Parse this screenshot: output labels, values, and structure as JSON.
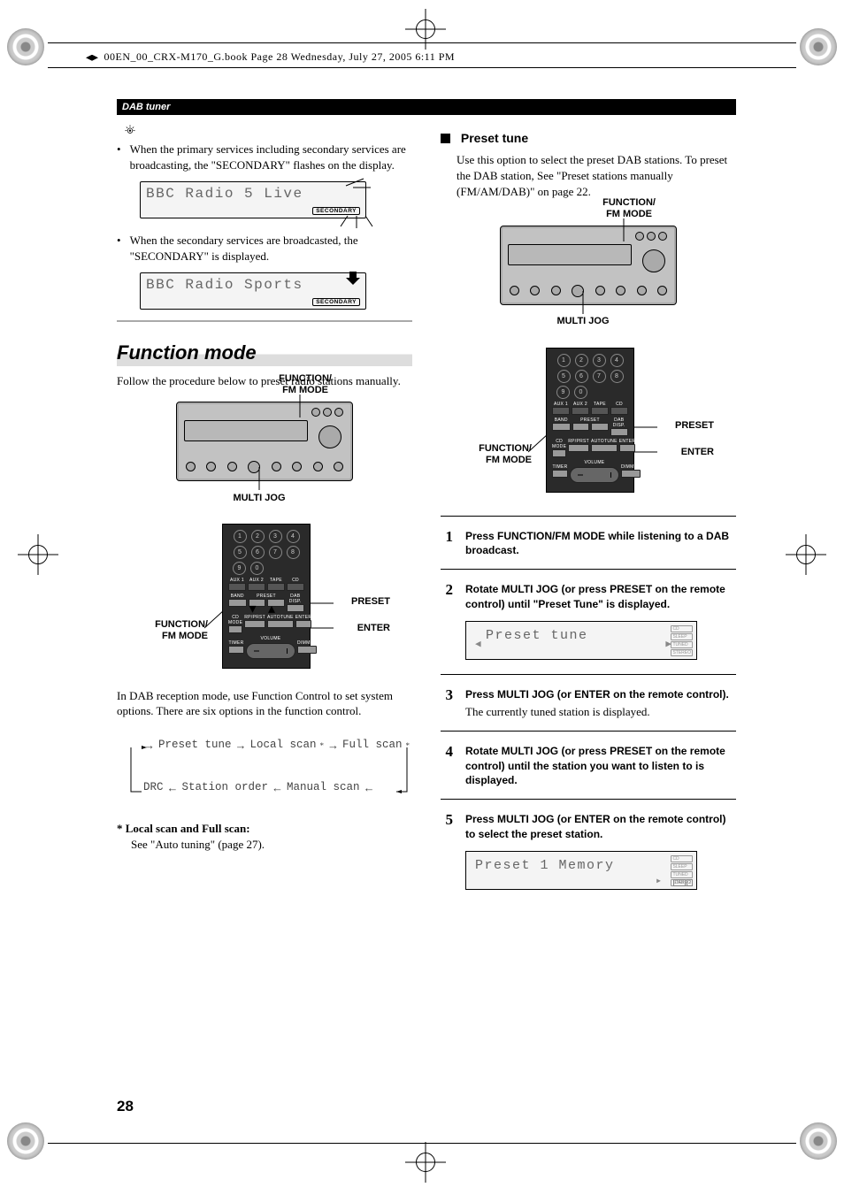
{
  "book_tag": "00EN_00_CRX-M170_G.book  Page 28  Wednesday, July 27, 2005  6:11 PM",
  "section_header": "DAB tuner",
  "left": {
    "bullet1": "When the primary services including secondary services are broadcasting, the \"SECONDARY\" flashes on the display.",
    "lcd1_text": "BBC Radio 5 Live",
    "lcd_badge": "SECONDARY",
    "bullet2": "When the secondary services are broadcasted, the \"SECONDARY\" is displayed.",
    "lcd2_text": "BBC Radio Sports",
    "function_title": "Function mode",
    "function_intro": "Follow the procedure below to preset radio stations manually.",
    "label_function_fm": "FUNCTION/\nFM MODE",
    "label_multijog": "MULTI JOG",
    "label_preset": "PRESET",
    "label_enter": "ENTER",
    "dab_para": "In DAB reception mode, use Function Control to set system options. There are six options  in the function control.",
    "flow": {
      "preset_tune": "Preset tune",
      "local_scan": "Local scan",
      "full_scan": "Full scan",
      "drc": "DRC",
      "station_order": "Station order",
      "manual_scan": "Manual scan"
    },
    "local_full_heading": "* Local scan and Full scan:",
    "local_full_body": "See \"Auto tuning\" (page 27)."
  },
  "right": {
    "preset_tune_h": "Preset tune",
    "preset_para": "Use this option to select the preset DAB stations. To preset the DAB station, See \"Preset stations manually (FM/AM/DAB)\" on page 22.",
    "label_function_fm": "FUNCTION/\nFM MODE",
    "label_multijog": "MULTI JOG",
    "label_preset": "PRESET",
    "label_enter": "ENTER",
    "remote_labels": {
      "aux1": "AUX 1",
      "aux2": "AUX 2",
      "tape": "TAPE",
      "cd": "CD",
      "band": "BAND",
      "preset": "PRESET",
      "dab_disp": "DAB DISP.",
      "cd_mode": "CD MODE",
      "repeat": "RP/PRST",
      "autotune": "AUTOTUNE",
      "enter": "ENTER",
      "timer": "TIMER",
      "volume": "VOLUME",
      "dimmer": "DIMMER"
    },
    "steps": {
      "s1": "Press FUNCTION/FM MODE while listening to a DAB broadcast.",
      "s2": "Rotate MULTI JOG (or press PRESET on the remote control) until \"Preset Tune\" is displayed.",
      "lcd2": "Preset tune",
      "s3_bold": "Press MULTI JOG (or ENTER on the remote control).",
      "s3_plain": "The currently tuned station is displayed.",
      "s4": "Rotate MULTI JOG (or press PRESET on the remote control) until the  station you want to listen to is displayed.",
      "s5": "Press MULTI JOG (or ENTER on the remote control) to select the preset station.",
      "lcd5": "Preset 1  Memory"
    }
  },
  "page_number": "28"
}
